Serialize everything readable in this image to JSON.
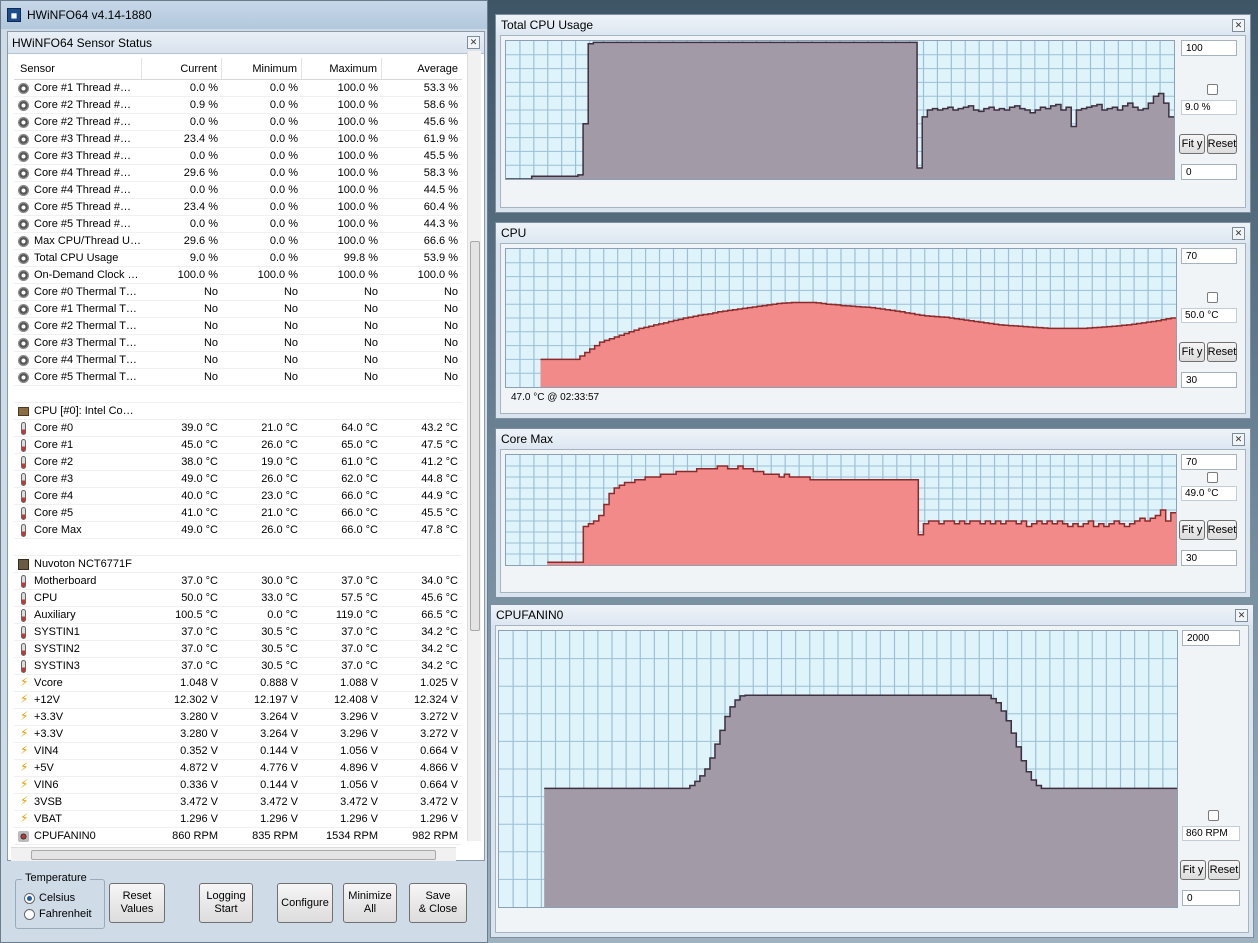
{
  "app": {
    "title": "HWiNFO64 v4.14-1880",
    "icon": "hwinfo-icon"
  },
  "sensor_window": {
    "title": "HWiNFO64 Sensor Status"
  },
  "columns": [
    "Sensor",
    "Current",
    "Minimum",
    "Maximum",
    "Average"
  ],
  "rows": [
    {
      "icon": "gear",
      "name": "Core #1 Thread #…",
      "cur": "0.0 %",
      "min": "0.0 %",
      "max": "100.0 %",
      "avg": "53.3 %"
    },
    {
      "icon": "gear",
      "name": "Core #2 Thread #…",
      "cur": "0.9 %",
      "min": "0.0 %",
      "max": "100.0 %",
      "avg": "58.6 %"
    },
    {
      "icon": "gear",
      "name": "Core #2 Thread #…",
      "cur": "0.0 %",
      "min": "0.0 %",
      "max": "100.0 %",
      "avg": "45.6 %"
    },
    {
      "icon": "gear",
      "name": "Core #3 Thread #…",
      "cur": "23.4 %",
      "min": "0.0 %",
      "max": "100.0 %",
      "avg": "61.9 %"
    },
    {
      "icon": "gear",
      "name": "Core #3 Thread #…",
      "cur": "0.0 %",
      "min": "0.0 %",
      "max": "100.0 %",
      "avg": "45.5 %"
    },
    {
      "icon": "gear",
      "name": "Core #4 Thread #…",
      "cur": "29.6 %",
      "min": "0.0 %",
      "max": "100.0 %",
      "avg": "58.3 %"
    },
    {
      "icon": "gear",
      "name": "Core #4 Thread #…",
      "cur": "0.0 %",
      "min": "0.0 %",
      "max": "100.0 %",
      "avg": "44.5 %"
    },
    {
      "icon": "gear",
      "name": "Core #5 Thread #…",
      "cur": "23.4 %",
      "min": "0.0 %",
      "max": "100.0 %",
      "avg": "60.4 %"
    },
    {
      "icon": "gear",
      "name": "Core #5 Thread #…",
      "cur": "0.0 %",
      "min": "0.0 %",
      "max": "100.0 %",
      "avg": "44.3 %"
    },
    {
      "icon": "gear",
      "name": "Max CPU/Thread U…",
      "cur": "29.6 %",
      "min": "0.0 %",
      "max": "100.0 %",
      "avg": "66.6 %"
    },
    {
      "icon": "gear",
      "name": "Total CPU Usage",
      "cur": "9.0 %",
      "min": "0.0 %",
      "max": "99.8 %",
      "avg": "53.9 %"
    },
    {
      "icon": "gear",
      "name": "On-Demand Clock …",
      "cur": "100.0 %",
      "min": "100.0 %",
      "max": "100.0 %",
      "avg": "100.0 %"
    },
    {
      "icon": "gear",
      "name": "Core #0 Thermal T…",
      "cur": "No",
      "min": "No",
      "max": "No",
      "avg": "No"
    },
    {
      "icon": "gear",
      "name": "Core #1 Thermal T…",
      "cur": "No",
      "min": "No",
      "max": "No",
      "avg": "No"
    },
    {
      "icon": "gear",
      "name": "Core #2 Thermal T…",
      "cur": "No",
      "min": "No",
      "max": "No",
      "avg": "No"
    },
    {
      "icon": "gear",
      "name": "Core #3 Thermal T…",
      "cur": "No",
      "min": "No",
      "max": "No",
      "avg": "No"
    },
    {
      "icon": "gear",
      "name": "Core #4 Thermal T…",
      "cur": "No",
      "min": "No",
      "max": "No",
      "avg": "No"
    },
    {
      "icon": "gear",
      "name": "Core #5 Thermal T…",
      "cur": "No",
      "min": "No",
      "max": "No",
      "avg": "No"
    },
    {
      "icon": "blank",
      "name": "",
      "cur": "",
      "min": "",
      "max": "",
      "avg": ""
    },
    {
      "icon": "cpu",
      "name": "CPU [#0]: Intel Co…",
      "cur": "",
      "min": "",
      "max": "",
      "avg": "",
      "group": true
    },
    {
      "icon": "therm",
      "name": "Core #0",
      "cur": "39.0 °C",
      "min": "21.0 °C",
      "max": "64.0 °C",
      "avg": "43.2 °C"
    },
    {
      "icon": "therm",
      "name": "Core #1",
      "cur": "45.0 °C",
      "min": "26.0 °C",
      "max": "65.0 °C",
      "avg": "47.5 °C"
    },
    {
      "icon": "therm",
      "name": "Core #2",
      "cur": "38.0 °C",
      "min": "19.0 °C",
      "max": "61.0 °C",
      "avg": "41.2 °C"
    },
    {
      "icon": "therm",
      "name": "Core #3",
      "cur": "49.0 °C",
      "min": "26.0 °C",
      "max": "62.0 °C",
      "avg": "44.8 °C"
    },
    {
      "icon": "therm",
      "name": "Core #4",
      "cur": "40.0 °C",
      "min": "23.0 °C",
      "max": "66.0 °C",
      "avg": "44.9 °C"
    },
    {
      "icon": "therm",
      "name": "Core #5",
      "cur": "41.0 °C",
      "min": "21.0 °C",
      "max": "66.0 °C",
      "avg": "45.5 °C"
    },
    {
      "icon": "therm",
      "name": "Core Max",
      "cur": "49.0 °C",
      "min": "26.0 °C",
      "max": "66.0 °C",
      "avg": "47.8 °C"
    },
    {
      "icon": "blank",
      "name": "",
      "cur": "",
      "min": "",
      "max": "",
      "avg": ""
    },
    {
      "icon": "chip",
      "name": "Nuvoton NCT6771F",
      "cur": "",
      "min": "",
      "max": "",
      "avg": "",
      "group": true
    },
    {
      "icon": "therm",
      "name": "Motherboard",
      "cur": "37.0 °C",
      "min": "30.0 °C",
      "max": "37.0 °C",
      "avg": "34.0 °C"
    },
    {
      "icon": "therm",
      "name": "CPU",
      "cur": "50.0 °C",
      "min": "33.0 °C",
      "max": "57.5 °C",
      "avg": "45.6 °C"
    },
    {
      "icon": "therm",
      "name": "Auxiliary",
      "cur": "100.5 °C",
      "min": "0.0 °C",
      "max": "119.0 °C",
      "avg": "66.5 °C"
    },
    {
      "icon": "therm",
      "name": "SYSTIN1",
      "cur": "37.0 °C",
      "min": "30.5 °C",
      "max": "37.0 °C",
      "avg": "34.2 °C"
    },
    {
      "icon": "therm",
      "name": "SYSTIN2",
      "cur": "37.0 °C",
      "min": "30.5 °C",
      "max": "37.0 °C",
      "avg": "34.2 °C"
    },
    {
      "icon": "therm",
      "name": "SYSTIN3",
      "cur": "37.0 °C",
      "min": "30.5 °C",
      "max": "37.0 °C",
      "avg": "34.2 °C"
    },
    {
      "icon": "volt",
      "name": "Vcore",
      "cur": "1.048 V",
      "min": "0.888 V",
      "max": "1.088 V",
      "avg": "1.025 V"
    },
    {
      "icon": "volt",
      "name": "+12V",
      "cur": "12.302 V",
      "min": "12.197 V",
      "max": "12.408 V",
      "avg": "12.324 V"
    },
    {
      "icon": "volt",
      "name": "+3.3V",
      "cur": "3.280 V",
      "min": "3.264 V",
      "max": "3.296 V",
      "avg": "3.272 V"
    },
    {
      "icon": "volt",
      "name": "+3.3V",
      "cur": "3.280 V",
      "min": "3.264 V",
      "max": "3.296 V",
      "avg": "3.272 V"
    },
    {
      "icon": "volt",
      "name": "VIN4",
      "cur": "0.352 V",
      "min": "0.144 V",
      "max": "1.056 V",
      "avg": "0.664 V"
    },
    {
      "icon": "volt",
      "name": "+5V",
      "cur": "4.872 V",
      "min": "4.776 V",
      "max": "4.896 V",
      "avg": "4.866 V"
    },
    {
      "icon": "volt",
      "name": "VIN6",
      "cur": "0.336 V",
      "min": "0.144 V",
      "max": "1.056 V",
      "avg": "0.664 V"
    },
    {
      "icon": "volt",
      "name": "3VSB",
      "cur": "3.472 V",
      "min": "3.472 V",
      "max": "3.472 V",
      "avg": "3.472 V"
    },
    {
      "icon": "volt",
      "name": "VBAT",
      "cur": "1.296 V",
      "min": "1.296 V",
      "max": "1.296 V",
      "avg": "1.296 V"
    },
    {
      "icon": "fan",
      "name": "CPUFANIN0",
      "cur": "860 RPM",
      "min": "835 RPM",
      "max": "1534 RPM",
      "avg": "982 RPM"
    }
  ],
  "bottom": {
    "temperature_label": "Temperature",
    "celsius": "Celsius",
    "fahrenheit": "Fahrenheit",
    "reset": [
      "Reset",
      "Values"
    ],
    "logging": [
      "Logging",
      "Start"
    ],
    "configure": "Configure",
    "minimize": [
      "Minimize",
      "All"
    ],
    "save": [
      "Save",
      "& Close"
    ]
  },
  "graphs": [
    {
      "title": "Total CPU Usage",
      "max_label": "100",
      "min_label": "0",
      "current": "9.0 %",
      "fit": "Fit y",
      "reset": "Reset",
      "footer": "",
      "color": "#a39aa8",
      "line": "#3d3040",
      "ymin": 0,
      "ymax": 100,
      "values": [
        0,
        0,
        0,
        0,
        0,
        2,
        2,
        2,
        2,
        2,
        2,
        2,
        2,
        2,
        3,
        40,
        98,
        99,
        99,
        99,
        99,
        99,
        99,
        99,
        99,
        99,
        99,
        99,
        99,
        99,
        99,
        99,
        99,
        99,
        99,
        99,
        99,
        99,
        99,
        99,
        99,
        99,
        99,
        99,
        99,
        99,
        99,
        99,
        99,
        99,
        99,
        99,
        99,
        99,
        99,
        99,
        99,
        99,
        99,
        99,
        99,
        99,
        99,
        99,
        99,
        99,
        99,
        99,
        99,
        99,
        99,
        99,
        99,
        99,
        99,
        99,
        99,
        99,
        99,
        99,
        8,
        45,
        50,
        51,
        50,
        51,
        52,
        50,
        51,
        52,
        53,
        50,
        49,
        51,
        52,
        50,
        51,
        50,
        52,
        53,
        51,
        50,
        48,
        50,
        52,
        51,
        53,
        54,
        50,
        52,
        38,
        50,
        51,
        52,
        53,
        54,
        50,
        51,
        52,
        50,
        53,
        55,
        52,
        50,
        51,
        55,
        60,
        62,
        55,
        45
      ]
    },
    {
      "title": "CPU",
      "max_label": "70",
      "min_label": "30",
      "current": "50.0 °C",
      "fit": "Fit y",
      "reset": "Reset",
      "footer": "47.0 °C @ 02:33:57",
      "color": "#f38a8a",
      "line": "#8b2a2a",
      "ymin": 30,
      "ymax": 70,
      "values": [
        null,
        null,
        null,
        null,
        null,
        null,
        null,
        38,
        38,
        38,
        38,
        38,
        38,
        38,
        38,
        39,
        40,
        41,
        42,
        43,
        43.5,
        44,
        44.5,
        45,
        45.5,
        46,
        46.5,
        47,
        47.3,
        47.6,
        48,
        48.3,
        48.6,
        49,
        49.3,
        49.6,
        50,
        50.2,
        50.5,
        50.8,
        51,
        51.2,
        51.5,
        51.8,
        52,
        52.2,
        52.4,
        52.6,
        52.8,
        53,
        53.2,
        53.4,
        53.6,
        53.8,
        54,
        54.2,
        54.3,
        54.4,
        54.5,
        54.5,
        54.5,
        54.5,
        54.5,
        54.4,
        54.2,
        54,
        53.9,
        53.8,
        53.6,
        53.5,
        53.4,
        53.3,
        53.2,
        53.1,
        53,
        52.8,
        52.6,
        52.4,
        52.2,
        52,
        51.8,
        51.5,
        51.3,
        51,
        50.8,
        50.6,
        50.5,
        50.4,
        50.3,
        50.2,
        50,
        49.8,
        49.6,
        49.4,
        49.2,
        49,
        48.8,
        48.6,
        48.4,
        48.2,
        48,
        47.9,
        47.8,
        47.7,
        47.6,
        47.5,
        47.4,
        47.3,
        47.2,
        47.1,
        47,
        47,
        47,
        47,
        47,
        47,
        47,
        47,
        47.1,
        47.2,
        47.3,
        47.4,
        47.5,
        47.6,
        47.7,
        47.9,
        48,
        48.2,
        48.4,
        48.6,
        48.8,
        49,
        49.2,
        49.5,
        49.8,
        50
      ]
    },
    {
      "title": "Core Max",
      "max_label": "70",
      "min_label": "30",
      "current": "49.0 °C",
      "fit": "Fit y",
      "reset": "Reset",
      "footer": "",
      "color": "#f38a8a",
      "line": "#8b2a2a",
      "ymin": 30,
      "ymax": 70,
      "values": [
        null,
        null,
        null,
        null,
        null,
        null,
        null,
        null,
        31,
        31,
        31,
        31,
        31,
        31,
        31,
        44,
        45,
        46,
        48,
        52,
        56,
        58,
        59,
        60,
        60,
        61,
        61,
        62,
        62,
        62,
        63,
        63,
        63,
        64,
        64,
        64,
        64,
        65,
        65,
        65,
        65,
        66,
        66,
        65,
        65,
        66,
        65,
        65,
        64,
        64,
        63,
        63,
        63,
        62,
        63,
        62,
        62,
        62,
        62,
        61,
        61,
        61,
        61,
        61,
        61,
        61,
        61,
        61,
        61,
        61,
        61,
        61,
        61,
        61,
        61,
        61,
        61,
        61,
        61,
        61,
        41,
        45,
        46,
        46,
        45,
        46,
        46,
        45,
        46,
        45,
        46,
        46,
        45,
        46,
        45,
        46,
        45,
        46,
        46,
        45,
        46,
        44,
        45,
        46,
        45,
        46,
        45,
        46,
        45,
        44,
        45,
        44,
        45,
        46,
        44,
        45,
        44,
        45,
        46,
        45,
        44,
        45,
        46,
        47,
        46,
        47,
        48,
        50,
        46,
        49
      ]
    },
    {
      "title": "CPUFANIN0",
      "max_label": "2000",
      "min_label": "0",
      "current": "860 RPM",
      "fit": "Fit y",
      "reset": "Reset",
      "footer": "",
      "color": "#a39aa8",
      "line": "#3d3040",
      "ymin": 0,
      "ymax": 2000,
      "values": [
        null,
        null,
        null,
        null,
        null,
        null,
        null,
        null,
        null,
        860,
        860,
        860,
        860,
        860,
        860,
        860,
        860,
        860,
        860,
        860,
        860,
        860,
        860,
        860,
        860,
        860,
        860,
        860,
        860,
        860,
        860,
        860,
        860,
        860,
        860,
        860,
        860,
        860,
        880,
        910,
        950,
        1000,
        1080,
        1180,
        1280,
        1380,
        1450,
        1500,
        1530,
        1534,
        1534,
        1534,
        1534,
        1534,
        1534,
        1534,
        1534,
        1534,
        1534,
        1534,
        1534,
        1534,
        1534,
        1534,
        1534,
        1534,
        1534,
        1534,
        1534,
        1534,
        1534,
        1534,
        1534,
        1534,
        1534,
        1534,
        1534,
        1534,
        1534,
        1534,
        1534,
        1534,
        1534,
        1534,
        1534,
        1534,
        1534,
        1534,
        1534,
        1534,
        1534,
        1534,
        1534,
        1534,
        1534,
        1534,
        1534,
        1534,
        1510,
        1480,
        1420,
        1350,
        1260,
        1160,
        1060,
        980,
        920,
        880,
        860,
        860,
        860,
        860,
        860,
        860,
        860,
        860,
        860,
        860,
        860,
        860,
        860,
        860,
        860,
        860,
        860,
        860,
        860,
        860,
        860,
        860,
        860,
        860,
        860,
        860,
        860
      ]
    }
  ]
}
